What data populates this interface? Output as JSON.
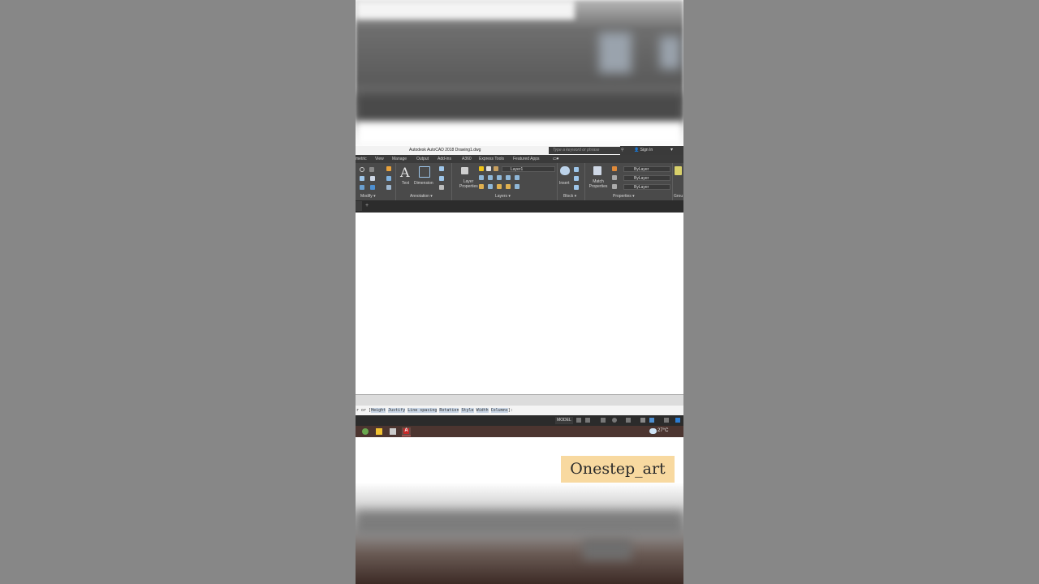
{
  "colors": {
    "side_bg": "#878787",
    "ribbon_bg": "#4a4a4a",
    "tab_bg": "#3b3b3b",
    "watermark_bg": "#f8d9a0",
    "taskbar_bg": "#4c3530"
  },
  "window": {
    "title": "Autodesk AutoCAD 2018   Drawing1.dwg",
    "search_placeholder": "Type a keyword or phrase",
    "sign_in": "Sign In"
  },
  "ribbon_tabs": [
    "metric",
    "View",
    "Manage",
    "Output",
    "Add-ins",
    "A360",
    "Express Tools",
    "Featured Apps"
  ],
  "ribbon": {
    "text_label": "Text",
    "dimension_label": "Dimension",
    "layer_properties_label": "Layer Properties",
    "layer_name": "Layer1",
    "insert_label": "Insert",
    "match_properties_label": "Match Properties",
    "bylayer_1": "ByLayer",
    "bylayer_2": "ByLayer",
    "bylayer_3": "ByLayer",
    "panels": {
      "modify": "Modify ▾",
      "annotation": "Annotation ▾",
      "layers": "Layers ▾",
      "block": "Block ▾",
      "properties": "Properties ▾",
      "groups": "Grou"
    }
  },
  "command_line": {
    "prefix": "r or [",
    "options": [
      "Height",
      "Justify",
      "Line spacing",
      "Rotation",
      "Style",
      "Width",
      "Columns"
    ],
    "suffix": "]:"
  },
  "status_bar": {
    "model": "MODEL"
  },
  "taskbar": {
    "weather": "27°C"
  },
  "watermark": "Onestep_art"
}
